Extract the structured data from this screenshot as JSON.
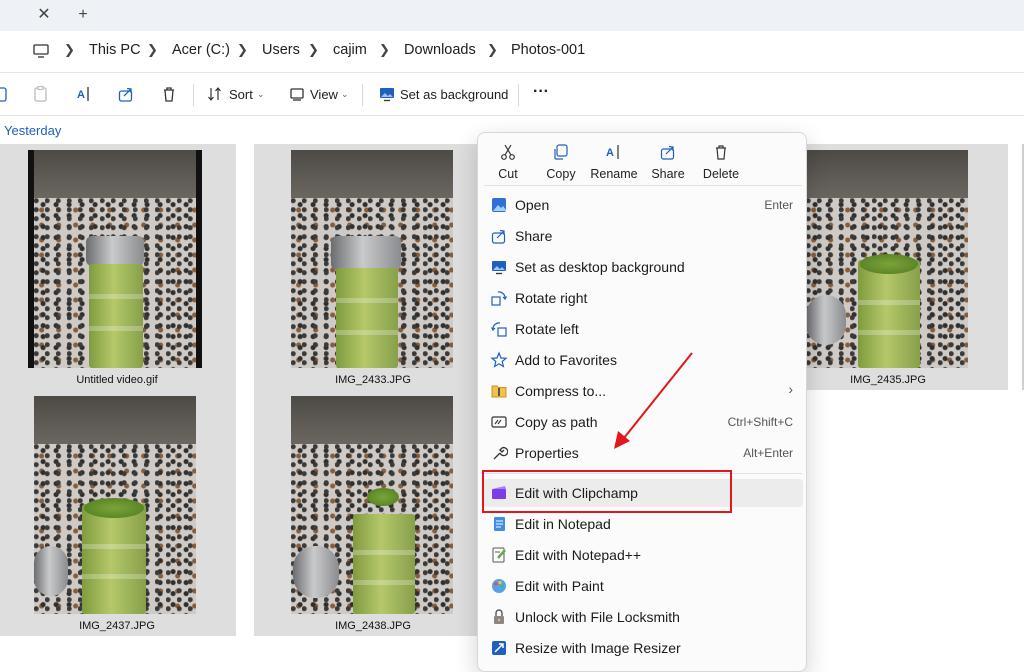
{
  "titlebar": {
    "close_glyph": "✕",
    "new_tab_glyph": "+"
  },
  "breadcrumb": [
    "This PC",
    "Acer (C:)",
    "Users",
    "cajim",
    "Downloads",
    "Photos-001"
  ],
  "toolbar": {
    "sort_label": "Sort",
    "view_label": "View",
    "set_bg_label": "Set as background",
    "more_glyph": "···"
  },
  "group_header": "Yesterday",
  "files": [
    {
      "name": "Untitled video.gif"
    },
    {
      "name": "IMG_2433.JPG"
    },
    {
      "name": "IMG_2435.JPG"
    },
    {
      "name": "IMG_2437.JPG"
    },
    {
      "name": "IMG_2438.JPG"
    }
  ],
  "context_menu": {
    "quick_actions": [
      {
        "label": "Cut",
        "icon": "scissors-icon"
      },
      {
        "label": "Copy",
        "icon": "copy-icon"
      },
      {
        "label": "Rename",
        "icon": "rename-icon"
      },
      {
        "label": "Share",
        "icon": "share-icon"
      },
      {
        "label": "Delete",
        "icon": "trash-icon"
      }
    ],
    "items": [
      {
        "label": "Open",
        "shortcut": "Enter",
        "icon": "image-icon"
      },
      {
        "label": "Share",
        "shortcut": "",
        "icon": "share-icon"
      },
      {
        "label": "Set as desktop background",
        "shortcut": "",
        "icon": "desktop-image-icon"
      },
      {
        "label": "Rotate right",
        "shortcut": "",
        "icon": "rotate-right-icon"
      },
      {
        "label": "Rotate left",
        "shortcut": "",
        "icon": "rotate-left-icon"
      },
      {
        "label": "Add to Favorites",
        "shortcut": "",
        "icon": "star-icon"
      },
      {
        "label": "Compress to...",
        "shortcut": "›",
        "icon": "zip-folder-icon"
      },
      {
        "label": "Copy as path",
        "shortcut": "Ctrl+Shift+C",
        "icon": "path-icon"
      },
      {
        "label": "Properties",
        "shortcut": "Alt+Enter",
        "icon": "wrench-icon"
      },
      {
        "label": "Edit with Clipchamp",
        "shortcut": "",
        "icon": "clipchamp-icon"
      },
      {
        "label": "Edit in Notepad",
        "shortcut": "",
        "icon": "notepad-icon"
      },
      {
        "label": "Edit with Notepad++",
        "shortcut": "",
        "icon": "notepadpp-icon"
      },
      {
        "label": "Edit with Paint",
        "shortcut": "",
        "icon": "paint-icon"
      },
      {
        "label": "Unlock with File Locksmith",
        "shortcut": "",
        "icon": "lock-icon"
      },
      {
        "label": "Resize with Image Resizer",
        "shortcut": "",
        "icon": "resize-icon"
      }
    ]
  },
  "colors": {
    "annotation": "#e0181b",
    "link_blue": "#1f5fbf",
    "clipchamp_purple": "#7b3fe4"
  }
}
